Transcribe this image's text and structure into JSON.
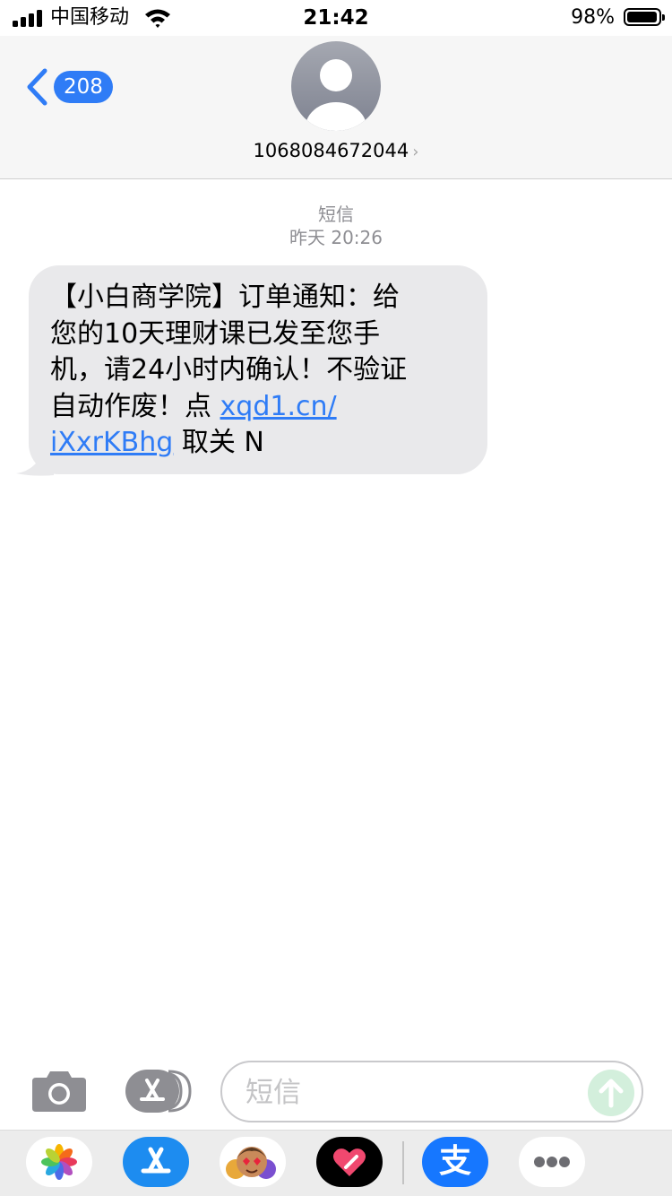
{
  "status_bar": {
    "carrier": "中国移动",
    "time": "21:42",
    "battery": "98%",
    "battery_level": 0.98
  },
  "header": {
    "back_count": "208",
    "contact": "1068084672044"
  },
  "conversation": {
    "service": "短信",
    "timestamp": "昨天 20:26",
    "message": {
      "line1": "【小白商学院】订单通知：给",
      "line2": "您的10天理财课已发至您手",
      "line3": "机，请24小时内确认！不验证",
      "line4_text": "自动作废！点 ",
      "link_part1": "xqd1.cn/",
      "link_part2": "iXxrKBhg",
      "line5_tail": " 取关 N"
    }
  },
  "compose": {
    "placeholder": "短信"
  },
  "app_drawer": {
    "apps": [
      "photos-app-icon",
      "app-store-icon",
      "memoji-icon",
      "digital-touch-icon",
      "alipay-icon",
      "more-apps-icon"
    ],
    "alipay_glyph": "支"
  },
  "colors": {
    "accent": "#2f7cf6",
    "bubble": "#e9e9eb",
    "send_disabled": "#d3efdc",
    "alipay": "#1677ff"
  }
}
